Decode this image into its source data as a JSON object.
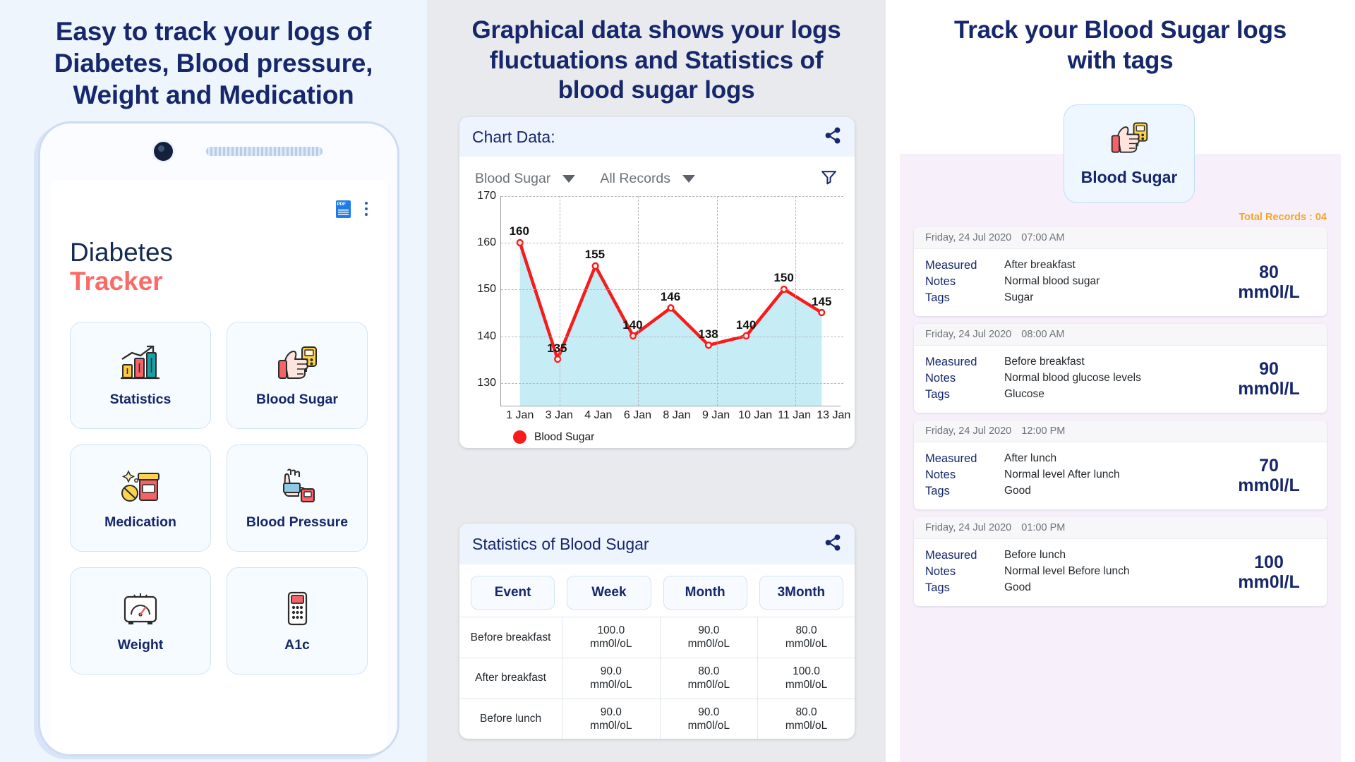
{
  "panel1": {
    "headline": "Easy to track your logs of Diabetes, Blood pressure, Weight and Medication",
    "app": {
      "title_line1": "Diabetes",
      "title_line2": "Tracker"
    },
    "appbar": {
      "pdf_label": "PDF",
      "menu_label": "More options"
    },
    "tiles": [
      {
        "label": "Statistics",
        "icon": "bar-chart-growth-icon"
      },
      {
        "label": "Blood Sugar",
        "icon": "glucometer-thumb-icon"
      },
      {
        "label": "Medication",
        "icon": "pills-bottle-icon"
      },
      {
        "label": "Blood Pressure",
        "icon": "bp-cuff-arm-icon"
      },
      {
        "label": "Weight",
        "icon": "weight-scale-icon"
      },
      {
        "label": "A1c",
        "icon": "a1c-device-icon"
      }
    ]
  },
  "panel2": {
    "headline": "Graphical data shows your logs fluctuations and Statistics of blood sugar logs",
    "chart_card": {
      "title": "Chart Data:",
      "share_icon": "share-icon",
      "filter_icon": "funnel-filter-icon",
      "type_select": "Blood Sugar",
      "range_select": "All Records"
    },
    "stats_card": {
      "title": "Statistics of Blood Sugar",
      "share_icon": "share-icon",
      "ranges": [
        "Event",
        "Week",
        "Month",
        "3Month"
      ],
      "rows": [
        {
          "event": "Before breakfast",
          "values": [
            "100.0 mm0l/oL",
            "90.0 mm0l/oL",
            "80.0 mm0l/oL"
          ]
        },
        {
          "event": "After breakfast",
          "values": [
            "90.0 mm0l/oL",
            "80.0 mm0l/oL",
            "100.0 mm0l/oL"
          ]
        },
        {
          "event": "Before lunch",
          "values": [
            "90.0 mm0l/oL",
            "90.0 mm0l/oL",
            "80.0 mm0l/oL"
          ]
        }
      ]
    }
  },
  "panel3": {
    "headline": "Track your Blood Sugar logs with tags",
    "tile": {
      "label": "Blood Sugar",
      "icon": "glucometer-thumb-icon"
    },
    "total_records": "Total Records : 04",
    "field_labels": {
      "measured": "Measured",
      "notes": "Notes",
      "tags": "Tags"
    },
    "records": [
      {
        "date": "Friday, 24  Jul 2020",
        "time": "07:00 AM",
        "measured": "After breakfast",
        "notes": "Normal blood sugar",
        "tags": "Sugar",
        "value": "80",
        "unit": "mm0l/L"
      },
      {
        "date": "Friday, 24  Jul 2020",
        "time": "08:00 AM",
        "measured": "Before breakfast",
        "notes": "Normal blood glucose levels",
        "tags": "Glucose",
        "value": "90",
        "unit": "mm0l/L"
      },
      {
        "date": "Friday, 24  Jul 2020",
        "time": "12:00 PM",
        "measured": "After lunch",
        "notes": "Normal level After lunch",
        "tags": "Good",
        "value": "70",
        "unit": "mm0l/L"
      },
      {
        "date": "Friday, 24  Jul 2020",
        "time": "01:00 PM",
        "measured": "Before lunch",
        "notes": "Normal level Before lunch",
        "tags": "Good",
        "value": "100",
        "unit": "mm0l/L"
      }
    ]
  },
  "colors": {
    "headline_navy": "#16276b",
    "accent_red": "#f71b1b",
    "line_fill": "#c6ecf5",
    "tracker_coral": "#fa6b68",
    "total_records_orange": "#f5a623"
  },
  "chart_data": {
    "type": "line",
    "title": "Chart Data:",
    "series_name": "Blood Sugar",
    "legend": [
      "Blood Sugar"
    ],
    "legend_position": "bottom-left",
    "xlabel": "",
    "ylabel": "",
    "grid": true,
    "ylim": [
      125,
      170
    ],
    "yticks": [
      130,
      140,
      150,
      160,
      170
    ],
    "categories": [
      "1 Jan",
      "3 Jan",
      "4 Jan",
      "6 Jan",
      "8 Jan",
      "9 Jan",
      "10 Jan",
      "11 Jan",
      "13 Jan"
    ],
    "values": [
      160,
      135,
      155,
      140,
      146,
      138,
      140,
      150,
      145
    ],
    "point_labels": [
      "160",
      "135",
      "155",
      "140",
      "146",
      "138",
      "140",
      "150",
      "145"
    ]
  }
}
